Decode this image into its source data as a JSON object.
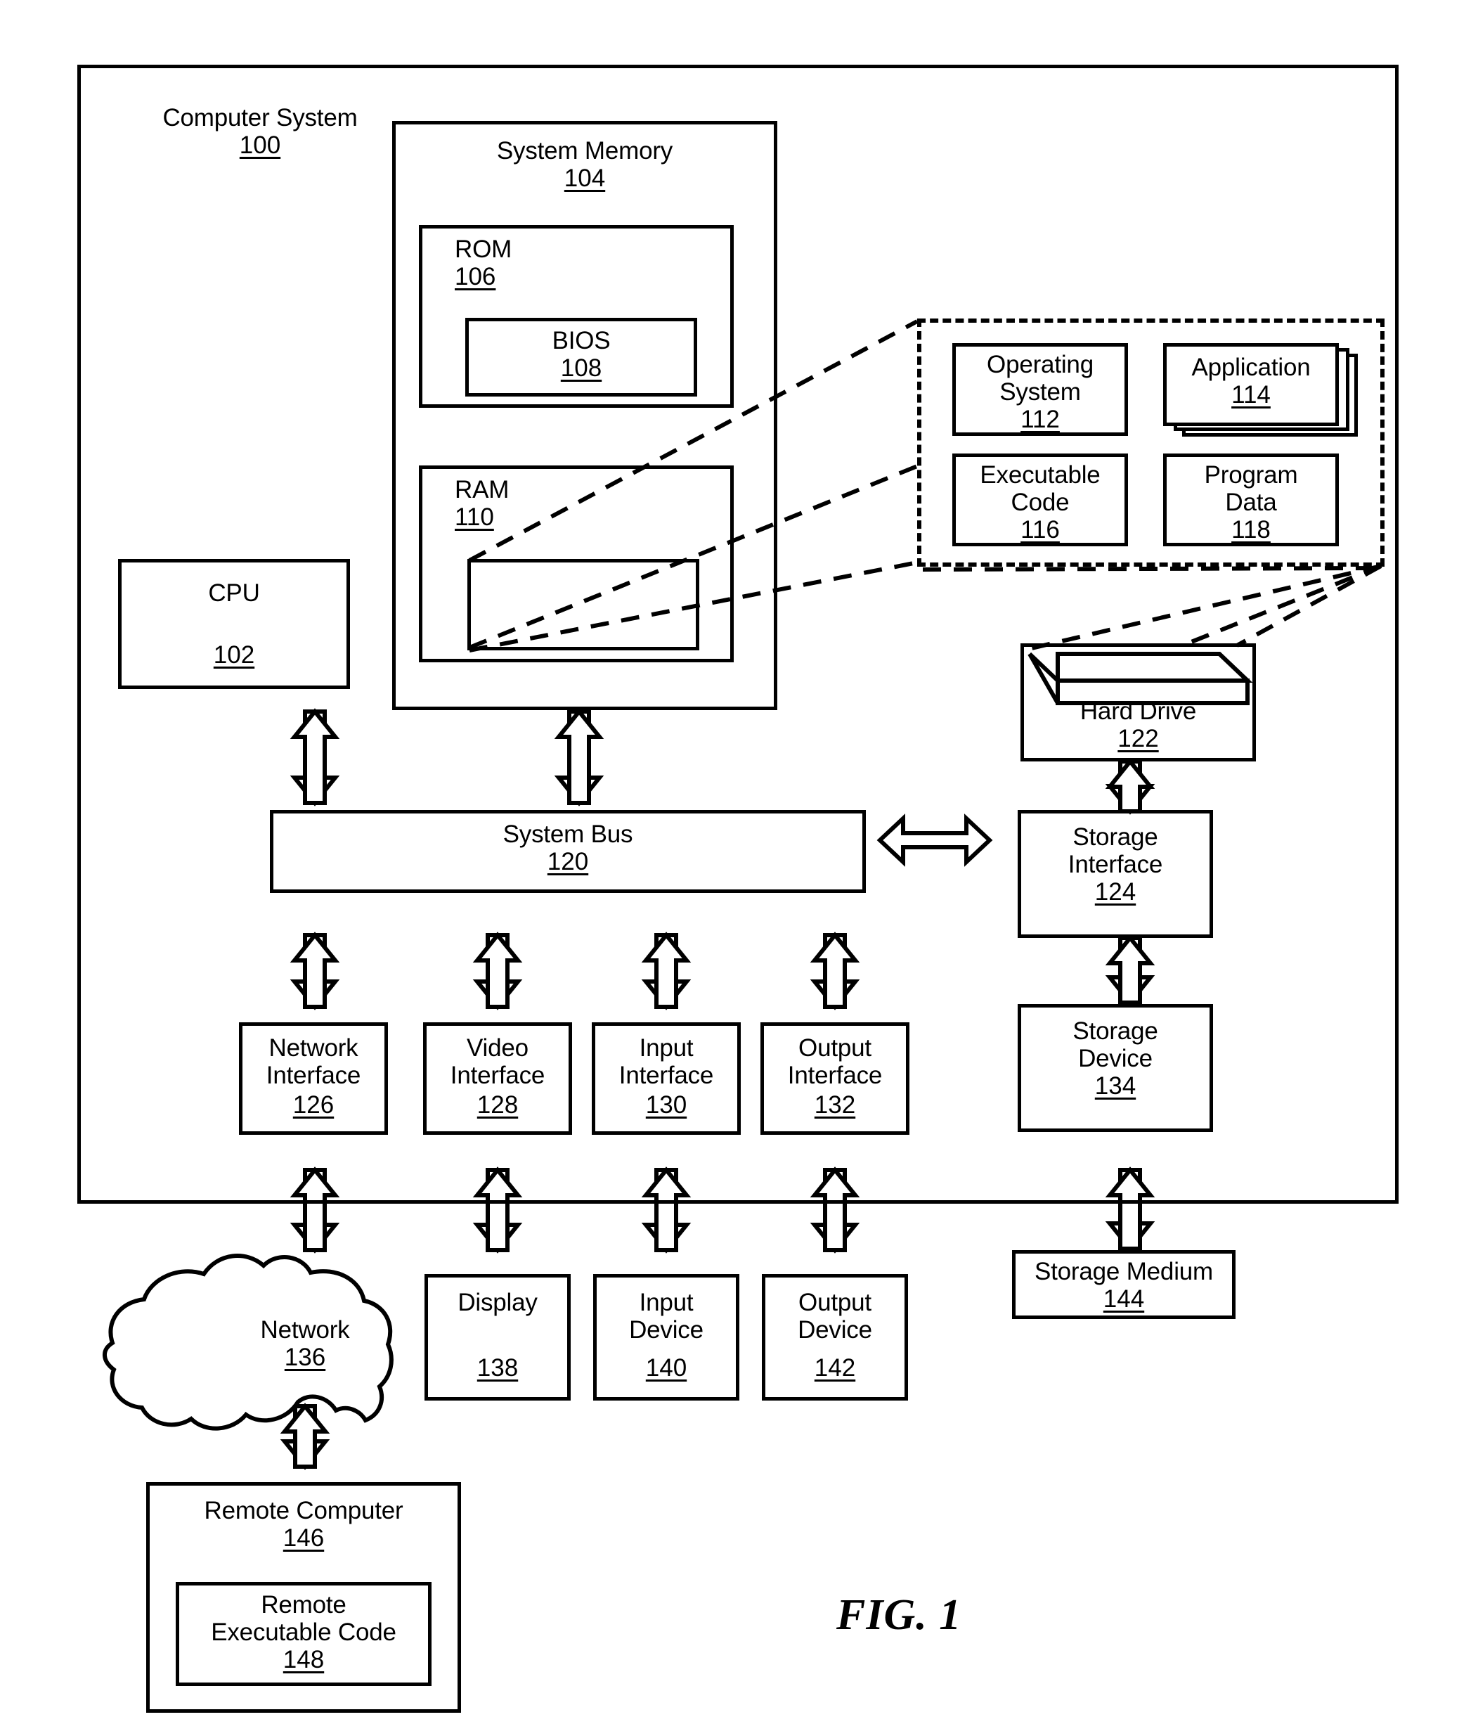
{
  "figure": {
    "caption": "FIG. 1"
  },
  "blocks": {
    "computer_system": {
      "label": "Computer System",
      "number": "100"
    },
    "system_memory": {
      "label": "System Memory",
      "number": "104"
    },
    "rom": {
      "label": "ROM",
      "number": "106"
    },
    "bios": {
      "label": "BIOS",
      "number": "108"
    },
    "ram": {
      "label": "RAM",
      "number": "110"
    },
    "cpu": {
      "label": "CPU",
      "number": "102"
    },
    "system_bus": {
      "label": "System Bus",
      "number": "120"
    },
    "operating_system": {
      "label": "Operating\nSystem",
      "number": "112"
    },
    "application": {
      "label": "Application",
      "number": "114"
    },
    "executable_code": {
      "label": "Executable\nCode",
      "number": "116"
    },
    "program_data": {
      "label": "Program\nData",
      "number": "118"
    },
    "hard_drive": {
      "label": "Hard Drive",
      "number": "122"
    },
    "storage_interface": {
      "label": "Storage\nInterface",
      "number": "124"
    },
    "storage_device": {
      "label": "Storage\nDevice",
      "number": "134"
    },
    "storage_medium": {
      "label": "Storage Medium",
      "number": "144"
    },
    "network_interface": {
      "label": "Network\nInterface",
      "number": "126"
    },
    "video_interface": {
      "label": "Video\nInterface",
      "number": "128"
    },
    "input_interface": {
      "label": "Input\nInterface",
      "number": "130"
    },
    "output_interface": {
      "label": "Output\nInterface",
      "number": "132"
    },
    "network": {
      "label": "Network",
      "number": "136"
    },
    "display": {
      "label": "Display",
      "number": "138"
    },
    "input_device": {
      "label": "Input\nDevice",
      "number": "140"
    },
    "output_device": {
      "label": "Output\nDevice",
      "number": "142"
    },
    "remote_computer": {
      "label": "Remote Computer",
      "number": "146"
    },
    "remote_executable_code": {
      "label": "Remote\nExecutable Code",
      "number": "148"
    }
  },
  "connectors": [
    {
      "name": "cpu-to-system-bus",
      "type": "double-arrow-vertical"
    },
    {
      "name": "system-memory-to-system-bus",
      "type": "double-arrow-vertical"
    },
    {
      "name": "system-bus-to-storage-interface",
      "type": "double-arrow-horizontal"
    },
    {
      "name": "hard-drive-to-storage-interface",
      "type": "double-arrow-vertical"
    },
    {
      "name": "storage-interface-to-storage-device",
      "type": "double-arrow-vertical"
    },
    {
      "name": "storage-device-to-storage-medium",
      "type": "double-arrow-vertical"
    },
    {
      "name": "system-bus-to-network-interface",
      "type": "double-arrow-vertical"
    },
    {
      "name": "system-bus-to-video-interface",
      "type": "double-arrow-vertical"
    },
    {
      "name": "system-bus-to-input-interface",
      "type": "double-arrow-vertical"
    },
    {
      "name": "system-bus-to-output-interface",
      "type": "double-arrow-vertical"
    },
    {
      "name": "network-interface-to-network",
      "type": "double-arrow-vertical"
    },
    {
      "name": "video-interface-to-display",
      "type": "double-arrow-vertical"
    },
    {
      "name": "input-interface-to-input-device",
      "type": "double-arrow-vertical"
    },
    {
      "name": "output-interface-to-output-device",
      "type": "double-arrow-vertical"
    },
    {
      "name": "network-to-remote-computer",
      "type": "double-arrow-vertical"
    },
    {
      "name": "ram-to-callout",
      "type": "dashed-leader"
    },
    {
      "name": "hard-drive-to-callout",
      "type": "dashed-leader"
    }
  ],
  "colors": {
    "stroke": "#000000",
    "background": "#ffffff"
  }
}
